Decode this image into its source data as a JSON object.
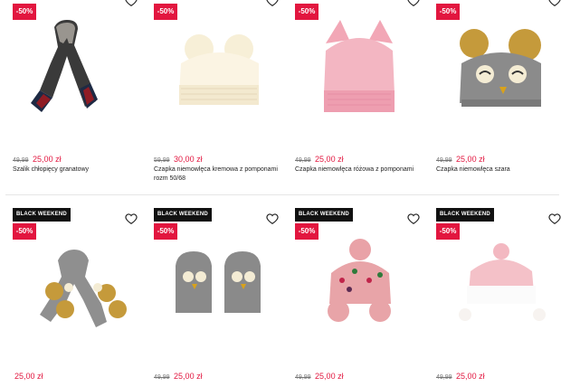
{
  "colors": {
    "sale_badge": "#e2163f",
    "black_weekend_badge": "#111111",
    "new_price": "#e2163f",
    "old_price": "#777777"
  },
  "products": [
    {
      "badge_black_weekend": "",
      "badge_sale": "-50%",
      "old_price": "49,99",
      "new_price": "25,00 zł",
      "name": "Szalik chłopięcy granatowy",
      "icon": "heart-icon"
    },
    {
      "badge_black_weekend": "",
      "badge_sale": "-50%",
      "old_price": "59,99",
      "new_price": "30,00 zł",
      "name": "Czapka niemowlęca kremowa z pomponami rozm 50/68",
      "icon": "heart-icon"
    },
    {
      "badge_black_weekend": "",
      "badge_sale": "-50%",
      "old_price": "49,99",
      "new_price": "25,00 zł",
      "name": "Czapka niemowlęca różowa z pomponami",
      "icon": "heart-icon"
    },
    {
      "badge_black_weekend": "",
      "badge_sale": "-50%",
      "old_price": "49,99",
      "new_price": "25,00 zł",
      "name": "Czapka niemowlęca szara",
      "icon": "heart-icon"
    },
    {
      "badge_black_weekend": "BLACK WEEKEND",
      "badge_sale": "-50%",
      "old_price": "",
      "new_price": "25,00 zł",
      "name": "",
      "icon": "heart-icon"
    },
    {
      "badge_black_weekend": "BLACK WEEKEND",
      "badge_sale": "-50%",
      "old_price": "49,99",
      "new_price": "25,00 zł",
      "name": "",
      "icon": "heart-icon"
    },
    {
      "badge_black_weekend": "BLACK WEEKEND",
      "badge_sale": "-50%",
      "old_price": "49,99",
      "new_price": "25,00 zł",
      "name": "",
      "icon": "heart-icon"
    },
    {
      "badge_black_weekend": "BLACK WEEKEND",
      "badge_sale": "-50%",
      "old_price": "49,99",
      "new_price": "25,00 zł",
      "name": "",
      "icon": "heart-icon"
    }
  ]
}
